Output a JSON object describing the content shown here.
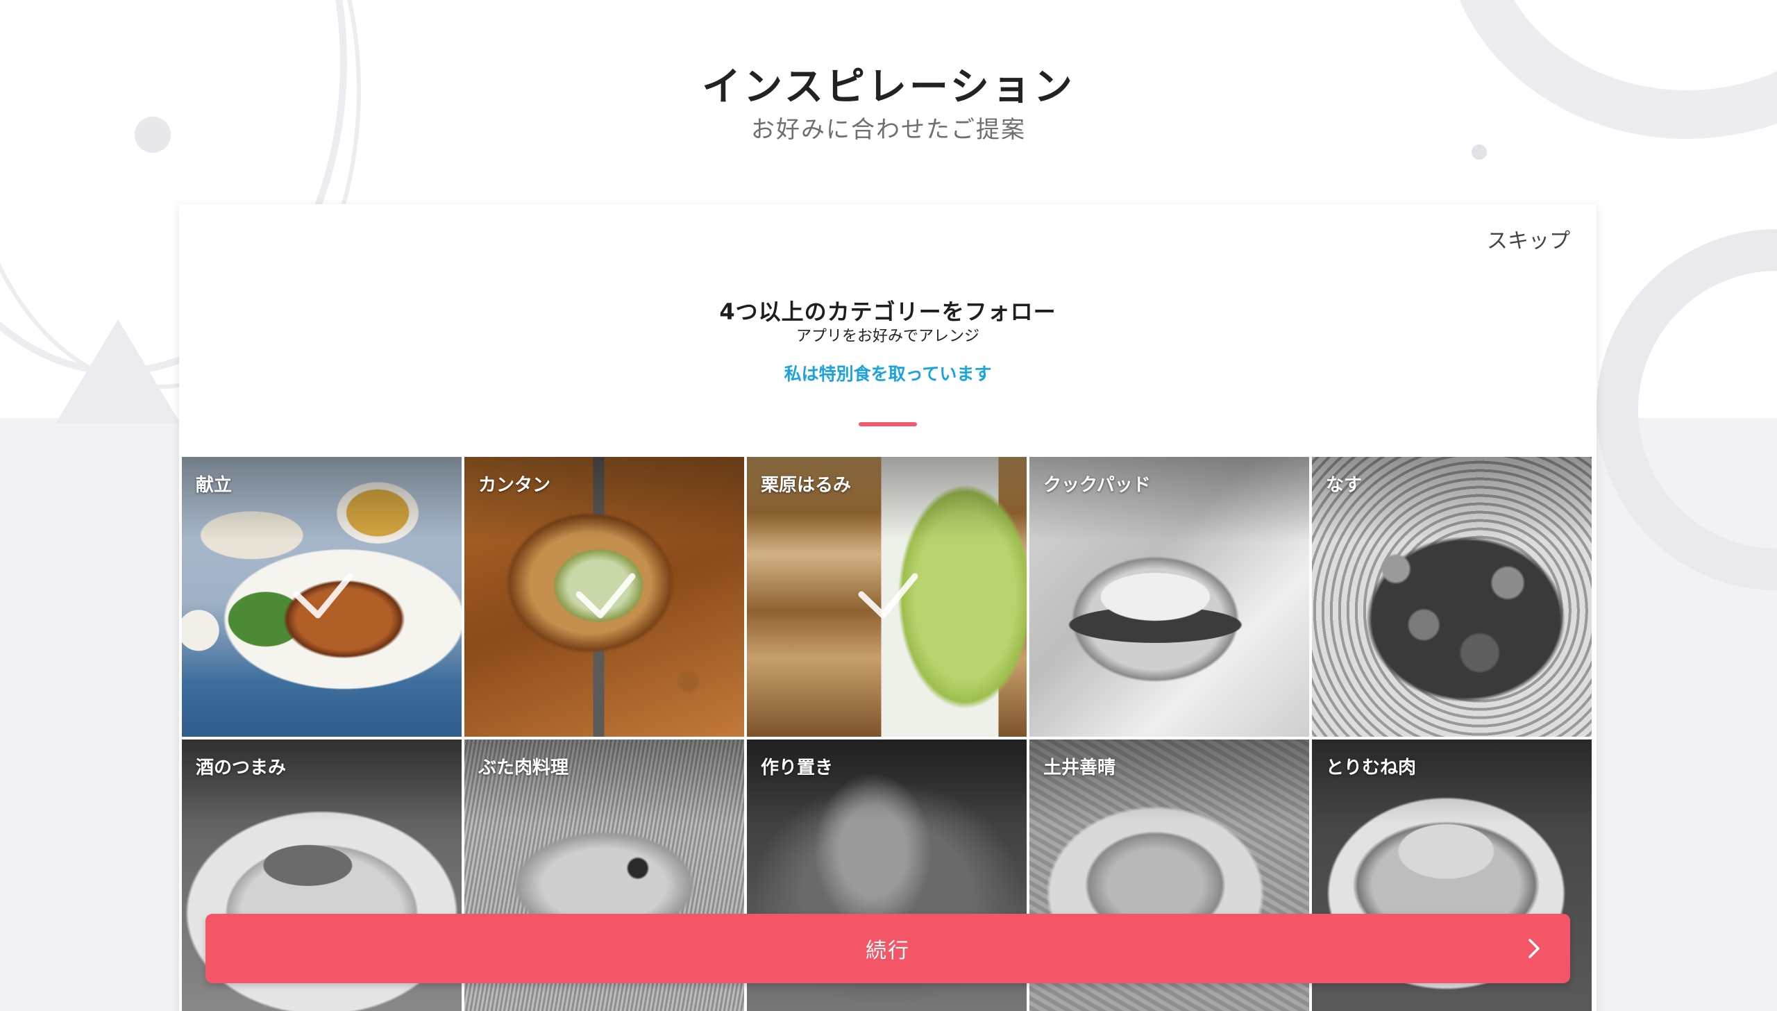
{
  "header": {
    "title": "インスピレーション",
    "subtitle": "お好みに合わせたご提案"
  },
  "card": {
    "skip_label": "スキップ",
    "title": "4つ以上のカテゴリーをフォロー",
    "subtitle": "アプリをお好みでアレンジ",
    "diet_link": "私は特別食を取っています",
    "tiles": [
      {
        "label": "献立",
        "selected": true
      },
      {
        "label": "カンタン",
        "selected": true
      },
      {
        "label": "栗原はるみ",
        "selected": true
      },
      {
        "label": "クックパッド",
        "selected": false
      },
      {
        "label": "なす",
        "selected": false
      },
      {
        "label": "酒のつまみ",
        "selected": false
      },
      {
        "label": "ぶた肉料理",
        "selected": false
      },
      {
        "label": "作り置き",
        "selected": false
      },
      {
        "label": "土井善晴",
        "selected": false
      },
      {
        "label": "とりむね肉",
        "selected": false
      }
    ]
  },
  "continue_button": {
    "label": "続行",
    "icon": "chevron-right-icon"
  },
  "colors": {
    "accent": "#f45668",
    "link": "#1aa3e0",
    "background": "#f2f2f5"
  }
}
